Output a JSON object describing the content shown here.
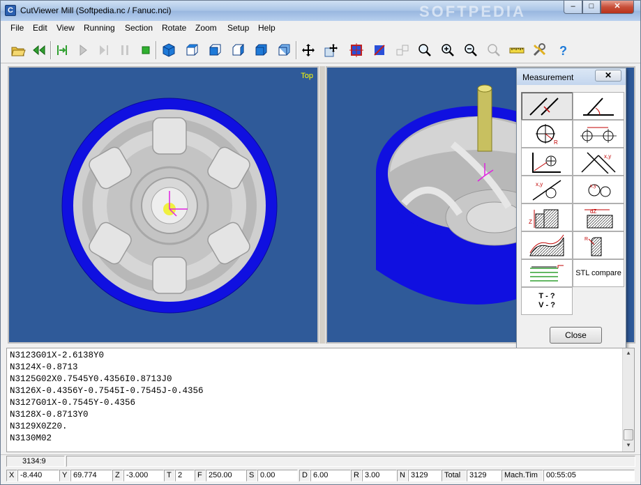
{
  "window": {
    "title": "CutViewer Mill (Softpedia.nc / Fanuc.nci)",
    "watermark": "SOFTPEDIA",
    "app_icon": "C"
  },
  "controls": {
    "minimize": "–",
    "maximize": "□",
    "close": "✕"
  },
  "menu": [
    "File",
    "Edit",
    "View",
    "Running",
    "Section",
    "Rotate",
    "Zoom",
    "Setup",
    "Help"
  ],
  "toolbar": {
    "icons": [
      "open-folder-icon",
      "rewind-icon",
      "step-icon",
      "play-icon",
      "skip-icon",
      "pause-icon",
      "stop-icon",
      "cube-iso-icon",
      "cube-top-icon",
      "cube-front-icon",
      "cube-right-icon",
      "cube-left-icon",
      "cube-back-icon",
      "pan-icon",
      "rotate-drag-icon",
      "section-x-icon",
      "section-y-icon",
      "dimension-icon",
      "zoom-window-icon",
      "zoom-in-icon",
      "zoom-out-icon",
      "zoom-fit-icon",
      "ruler-icon",
      "tools-icon",
      "help-icon"
    ]
  },
  "views": {
    "left_label": "Top",
    "right_label": ""
  },
  "code_lines": [
    "N3123G01X-2.6138Y0",
    "N3124X-0.8713",
    "N3125G02X0.7545Y0.4356I0.8713J0",
    "N3126X-0.4356Y-0.7545I-0.7545J-0.4356",
    "N3127G01X-0.7545Y-0.4356",
    "N3128X-0.8713Y0",
    "N3129X0Z20.",
    "N3130M02"
  ],
  "status_position": "3134:9",
  "status": {
    "x_label": "X",
    "x_value": "-8.440",
    "y_label": "Y",
    "y_value": "69.774",
    "z_label": "Z",
    "z_value": "-3.000",
    "t_label": "T",
    "t_value": "2",
    "f_label": "F",
    "f_value": "250.00",
    "s_label": "S",
    "s_value": "0.00",
    "d_label": "D",
    "d_value": "6.00",
    "r_label": "R",
    "r_value": "3.00",
    "n_label": "N",
    "n_value": "3129",
    "total_label": "Total",
    "total_value": "3129",
    "mach_label": "Mach.Tim",
    "mach_value": "00:55:05"
  },
  "measurement": {
    "title": "Measurement",
    "close_x": "✕",
    "stl_compare": "STL compare",
    "tv_line1": "T - ?",
    "tv_line2": "V - ?",
    "close_button": "Close",
    "icons": [
      "line-distance-icon",
      "angle-icon",
      "circle-radius-icon",
      "circle-center-distance-icon",
      "point-to-circle-icon",
      "line-intersection-icon",
      "point-xy-icon",
      "two-circles-icon",
      "depth-z-icon",
      "step-height-icon",
      "surface-profile-icon",
      "edge-radius-icon",
      "hatched-layers-icon"
    ]
  },
  "colors": {
    "viewport_bg": "#2f5a99",
    "stock_blue": "#1010e0",
    "highlight_yellow": "#ffff00"
  }
}
